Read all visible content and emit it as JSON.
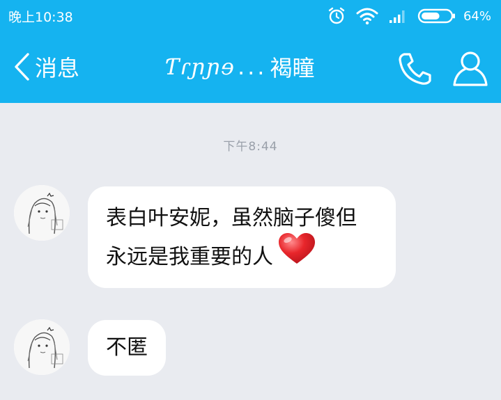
{
  "status_bar": {
    "time": "晚上10:38",
    "battery_percent": "64%",
    "battery_level": 0.64,
    "icons": [
      "alarm-icon",
      "wifi-icon",
      "signal-icon",
      "battery-icon"
    ]
  },
  "nav": {
    "back_label": "消息",
    "title_deco": "Ƭɾɲɲɘ",
    "title_ellipsis": "...",
    "title_name": "褐瞳",
    "call_icon": "phone-icon",
    "profile_icon": "person-icon"
  },
  "chat": {
    "timestamp": "下午8:44",
    "messages": [
      {
        "line1": "表白叶安妮，虽然脑子傻但",
        "line2": "永远是我重要的人",
        "emoji": "heart-icon"
      },
      {
        "text": "不匿"
      }
    ]
  },
  "colors": {
    "accent": "#15b3f0",
    "background": "#e9ebf0",
    "bubble": "#ffffff",
    "timestamp": "#9aa0aa",
    "heart": "#e8262b"
  }
}
